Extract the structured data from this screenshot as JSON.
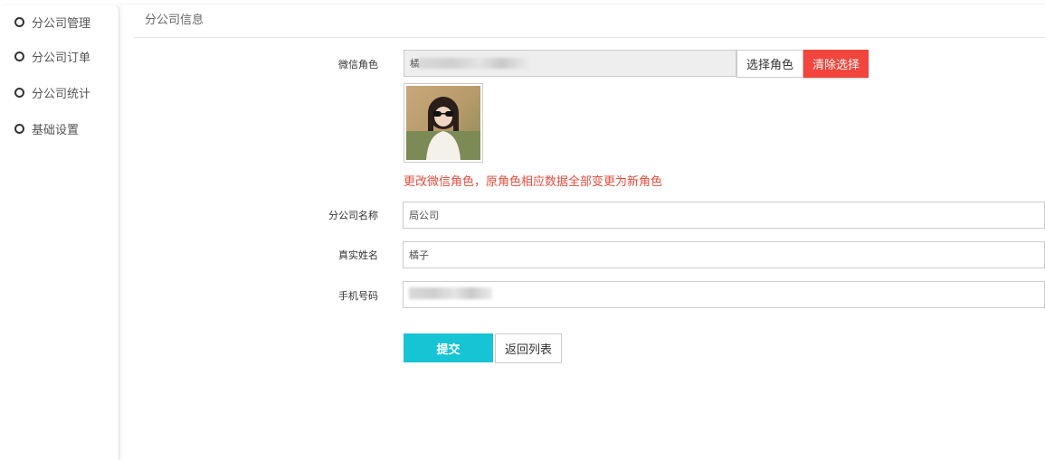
{
  "sidebar": {
    "items": [
      {
        "label": "分公司管理",
        "icon": "circle-icon"
      },
      {
        "label": "分公司订单",
        "icon": "circle-icon"
      },
      {
        "label": "分公司统计",
        "icon": "circle-icon"
      },
      {
        "label": "基础设置",
        "icon": "circle-icon"
      }
    ]
  },
  "header": {
    "title": "分公司信息"
  },
  "form": {
    "wechat_role": {
      "label": "微信角色",
      "value": "橘",
      "select_button": "选择角色",
      "clear_button": "清除选择",
      "hint": "更改微信角色，原角色相应数据全部变更为新角色"
    },
    "company_name": {
      "label": "分公司名称",
      "value": "局公司"
    },
    "real_name": {
      "label": "真实姓名",
      "value": "橘子"
    },
    "phone": {
      "label": "手机号码",
      "value": ""
    },
    "submit_button": "提交",
    "back_button": "返回列表"
  },
  "colors": {
    "accent": "#17c4d4",
    "danger": "#f2453d",
    "hint": "#e84c3d"
  }
}
